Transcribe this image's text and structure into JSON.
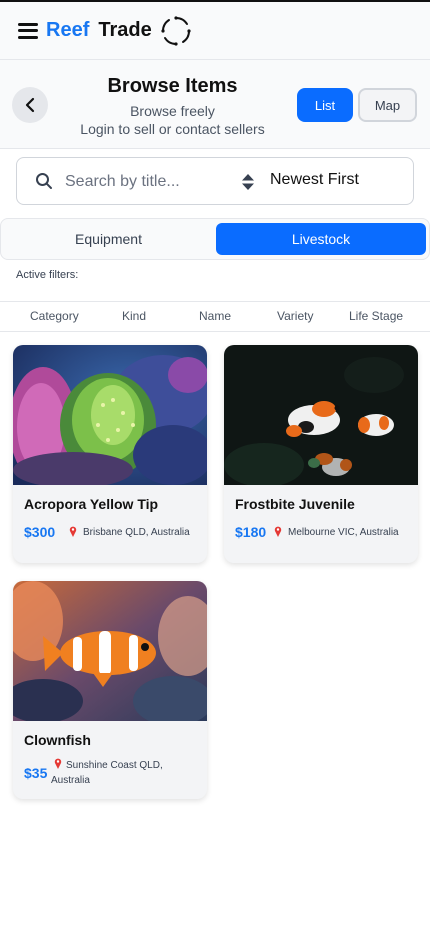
{
  "app": {
    "brand_reef": "Reef",
    "brand_trade": "Trade",
    "brand_color": "#1877f2",
    "accent": "#0a6cff"
  },
  "header": {
    "title": "Browse Items",
    "subtitle": "Browse freely",
    "subtitle2": "Login to sell or contact sellers",
    "view_list": "List",
    "view_map": "Map",
    "active_view": "List"
  },
  "search": {
    "placeholder": "Search by title...",
    "value": ""
  },
  "sort": {
    "selected": "Newest First"
  },
  "type_tabs": {
    "equipment": "Equipment",
    "livestock": "Livestock",
    "active": "Livestock"
  },
  "active_filters_label": "Active filters:",
  "filters": [
    "Category",
    "Kind",
    "Name",
    "Variety",
    "Life Stage"
  ],
  "items": [
    {
      "name": "Acropora Yellow Tip",
      "price": "$300",
      "location": "Brisbane QLD, Australia",
      "image": "coral"
    },
    {
      "name": "Frostbite Juvenile",
      "price": "$180",
      "location": "Melbourne VIC, Australia",
      "image": "clownfish-dark"
    },
    {
      "name": "Clownfish",
      "price": "$35",
      "location_line1": "Sunshine Coast QLD,",
      "location_line2": "Australia",
      "image": "clownfish-anemone"
    }
  ]
}
